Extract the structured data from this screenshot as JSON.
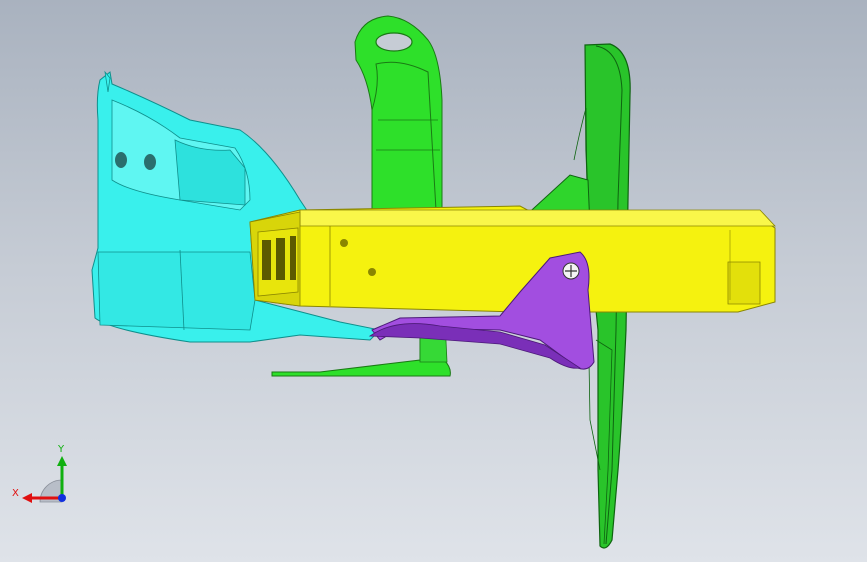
{
  "viewport": {
    "background_top": "#a9b2bf",
    "background_bottom": "#dfe3e9"
  },
  "parts": [
    {
      "name": "cyan-bracket",
      "color": "#39f0ec"
    },
    {
      "name": "green-arm",
      "color": "#2ee02a"
    },
    {
      "name": "yellow-box",
      "color": "#f5f20f"
    },
    {
      "name": "green-plate",
      "color": "#29c42a"
    },
    {
      "name": "purple-gusset",
      "color": "#a24ee0"
    }
  ],
  "triad": {
    "x_label": "X",
    "y_label": "Y",
    "x_color": "#e01010",
    "y_color": "#10b010",
    "z_color": "#1030e0"
  }
}
